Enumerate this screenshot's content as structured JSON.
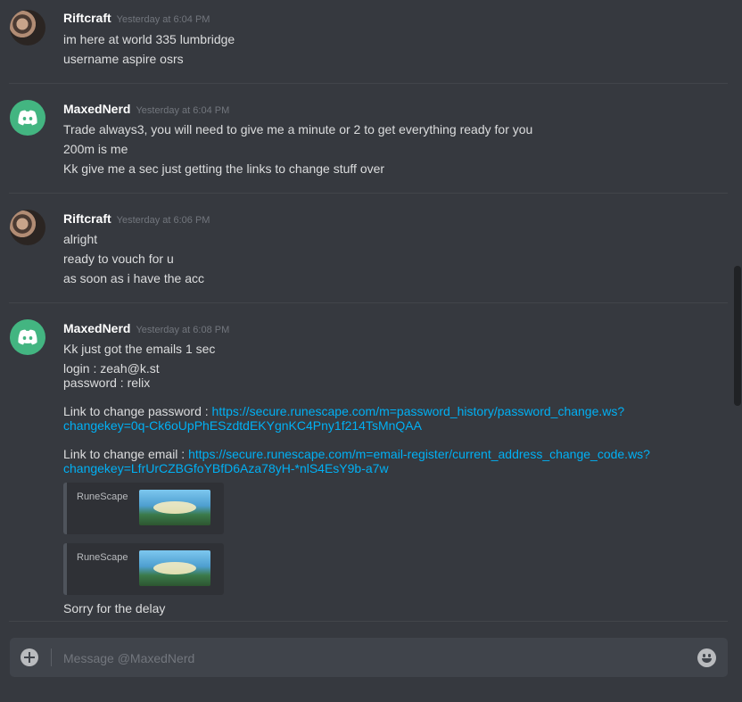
{
  "messages": [
    {
      "username": "Riftcraft",
      "timestamp": "Yesterday at 6:04 PM",
      "lines": [
        "im here at world 335 lumbridge",
        "username aspire osrs"
      ]
    },
    {
      "username": "MaxedNerd",
      "timestamp": "Yesterday at 6:04 PM",
      "lines": [
        "Trade always3, you will need to give me a minute or 2 to get everything ready for you",
        "200m is me",
        "Kk give me a sec just getting the links to change stuff over"
      ]
    },
    {
      "username": "Riftcraft",
      "timestamp": "Yesterday at 6:06 PM",
      "lines": [
        "alright",
        "ready to vouch for u",
        "as soon as i have the acc"
      ]
    },
    {
      "username": "MaxedNerd",
      "timestamp": "Yesterday at 6:08 PM",
      "lines": [
        "Kk just got the emails 1 sec",
        "login : zeah@k.st",
        "password : relix"
      ],
      "password_link": {
        "label": "Link to change password : ",
        "url_line1": "https://secure.runescape.com/m=password_history/password_change.ws?",
        "url_line2": "changekey=0q-Ck6oUpPhESzdtdEKYgnKC4Pny1f214TsMnQAA"
      },
      "email_link": {
        "label": "Link to change email : ",
        "url_line1": "https://secure.runescape.com/m=email-register/current_address_change_code.ws?",
        "url_line2": "changekey=LfrUrCZBGfoYBfD6Aza78yH-*nlS4EsY9b-a7w"
      },
      "embeds": [
        {
          "provider": "RuneScape",
          "image_icon": "runescape-banner"
        },
        {
          "provider": "RuneScape",
          "image_icon": "runescape-banner"
        }
      ],
      "final_line": "Sorry for the delay"
    }
  ],
  "composer": {
    "placeholder": "Message @MaxedNerd",
    "upload_icon": "plus-circle-icon",
    "emoji_icon": "smiley-icon"
  },
  "colors": {
    "background": "#36393f",
    "link": "#00b0f4",
    "discord_avatar": "#43b581"
  }
}
